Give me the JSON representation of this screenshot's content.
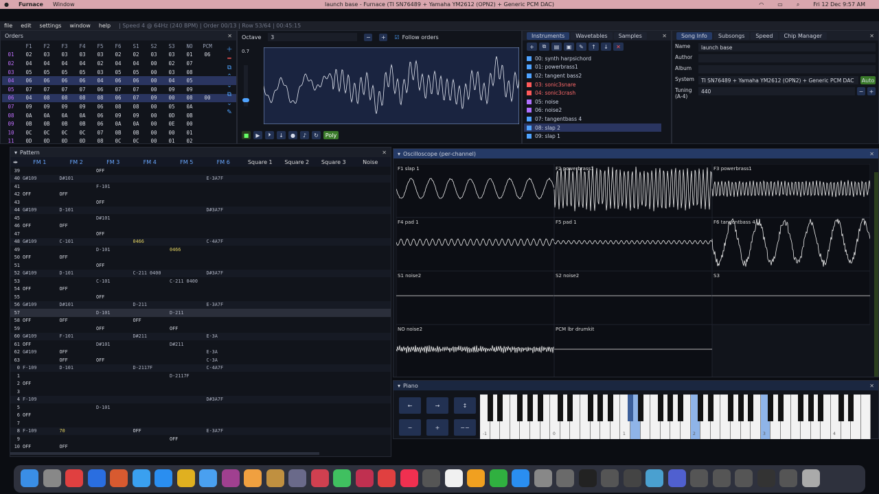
{
  "mac": {
    "apple": "",
    "app": "Furnace",
    "menu": "Window",
    "title": "launch base - Furnace (TI SN76489 + Yamaha YM2612 (OPN2) + Generic PCM DAC)",
    "datetime": "Fri 12 Dec 9:57 AM"
  },
  "menu": {
    "items": [
      "file",
      "edit",
      "settings",
      "window",
      "help"
    ],
    "status": "| Speed 4 @ 64Hz (240 BPM) | Order 00/13 | Row 53/64 | 00:45:15"
  },
  "orders": {
    "title": "Orders",
    "headers": [
      "F1",
      "F2",
      "F3",
      "F4",
      "F5",
      "F6",
      "S1",
      "S2",
      "S3",
      "NO",
      "PCM"
    ],
    "rows": [
      {
        "n": "01",
        "c": [
          "02",
          "03",
          "03",
          "03",
          "03",
          "02",
          "02",
          "03",
          "03",
          "01",
          "06"
        ]
      },
      {
        "n": "02",
        "c": [
          "04",
          "04",
          "04",
          "04",
          "02",
          "04",
          "04",
          "00",
          "02",
          "07"
        ]
      },
      {
        "n": "03",
        "c": [
          "05",
          "05",
          "05",
          "05",
          "03",
          "05",
          "05",
          "00",
          "03",
          "08"
        ]
      },
      {
        "n": "04",
        "c": [
          "06",
          "06",
          "06",
          "06",
          "04",
          "06",
          "06",
          "00",
          "04",
          "05"
        ]
      },
      {
        "n": "05",
        "c": [
          "07",
          "07",
          "07",
          "07",
          "06",
          "07",
          "07",
          "00",
          "09",
          "09"
        ]
      },
      {
        "n": "06",
        "c": [
          "04",
          "08",
          "08",
          "08",
          "08",
          "06",
          "07",
          "09",
          "00",
          "08",
          "00"
        ]
      },
      {
        "n": "07",
        "c": [
          "09",
          "09",
          "09",
          "09",
          "06",
          "08",
          "08",
          "00",
          "05",
          "0A"
        ]
      },
      {
        "n": "08",
        "c": [
          "0A",
          "0A",
          "0A",
          "0A",
          "06",
          "09",
          "09",
          "00",
          "0D",
          "0B"
        ]
      },
      {
        "n": "09",
        "c": [
          "0B",
          "0B",
          "0B",
          "0B",
          "06",
          "0A",
          "0A",
          "00",
          "0E",
          "00"
        ]
      },
      {
        "n": "10",
        "c": [
          "0C",
          "0C",
          "0C",
          "0C",
          "07",
          "0B",
          "0B",
          "00",
          "00",
          "01"
        ]
      },
      {
        "n": "11",
        "c": [
          "0D",
          "0D",
          "0D",
          "0D",
          "08",
          "0C",
          "0C",
          "00",
          "01",
          "02"
        ]
      }
    ]
  },
  "osc": {
    "title": "Octave",
    "octave": "3",
    "zoom": "0.7",
    "follow": "Follow orders",
    "poly": "Poly"
  },
  "instruments": {
    "tabs": [
      "Instruments",
      "Wavetables",
      "Samples"
    ],
    "items": [
      {
        "label": "00: synth harpsichord",
        "color": "#4fa3ff"
      },
      {
        "label": "01: powerbrass1",
        "color": "#4fa3ff"
      },
      {
        "label": "02: tangent bass2",
        "color": "#4fa3ff"
      },
      {
        "label": "03: sonic3snare",
        "color": "#ff5a5a"
      },
      {
        "label": "04: sonic3crash",
        "color": "#ff5a5a"
      },
      {
        "label": "05: noise",
        "color": "#b070ff"
      },
      {
        "label": "06: noise2",
        "color": "#b070ff"
      },
      {
        "label": "07: tangentbass 4",
        "color": "#4fa3ff"
      },
      {
        "label": "08: slap 2",
        "color": "#4fa3ff"
      },
      {
        "label": "09: slap 1",
        "color": "#4fa3ff"
      }
    ]
  },
  "song": {
    "tabs": [
      "Song Info",
      "Subsongs",
      "Speed",
      "Chip Manager"
    ],
    "name_label": "Name",
    "name": "launch base",
    "author_label": "Author",
    "author": "",
    "album_label": "Album",
    "album": "",
    "system_label": "System",
    "system": "TI SN76489 + Yamaha YM2612 (OPN2) + Generic PCM DAC",
    "auto": "Auto",
    "tuning_label": "Tuning (A-4)",
    "tuning": "440"
  },
  "pattern": {
    "title": "Pattern",
    "channels": [
      "FM 1",
      "FM 2",
      "FM 3",
      "FM 4",
      "FM 5",
      "FM 6",
      "Square 1",
      "Square 2",
      "Square 3",
      "Noise"
    ],
    "rows": [
      {
        "n": "39",
        "c": [
          "",
          "",
          "OFF",
          "",
          "",
          "",
          "",
          "",
          "",
          ""
        ]
      },
      {
        "n": "40",
        "c": [
          "G#109",
          "D#101",
          "",
          "",
          "",
          "E-3A7F",
          "",
          "",
          "",
          ""
        ]
      },
      {
        "n": "41",
        "c": [
          "",
          "",
          "F-101",
          "",
          "",
          "",
          "",
          "",
          "",
          ""
        ]
      },
      {
        "n": "42",
        "c": [
          "OFF",
          "OFF",
          "",
          "",
          "",
          "",
          "",
          "",
          "",
          ""
        ]
      },
      {
        "n": "43",
        "c": [
          "",
          "",
          "OFF",
          "",
          "",
          "",
          "",
          "",
          "",
          ""
        ]
      },
      {
        "n": "44",
        "c": [
          "G#109",
          "D-101",
          "",
          "",
          "",
          "D#3A7F",
          "",
          "",
          "",
          ""
        ]
      },
      {
        "n": "45",
        "c": [
          "",
          "",
          "D#101",
          "",
          "",
          "",
          "",
          "",
          "",
          ""
        ]
      },
      {
        "n": "46",
        "c": [
          "OFF",
          "OFF",
          "",
          "",
          "",
          "",
          "",
          "",
          "",
          ""
        ]
      },
      {
        "n": "47",
        "c": [
          "",
          "",
          "OFF",
          "",
          "",
          "",
          "",
          "",
          "",
          ""
        ]
      },
      {
        "n": "48",
        "c": [
          "G#109",
          "C-101",
          "",
          "0466",
          "",
          "C-4A7F",
          "",
          "",
          "",
          ""
        ]
      },
      {
        "n": "49",
        "c": [
          "",
          "",
          "D-101",
          "",
          "0466",
          "",
          "",
          "",
          "",
          ""
        ]
      },
      {
        "n": "50",
        "c": [
          "OFF",
          "OFF",
          "",
          "",
          "",
          "",
          "",
          "",
          "",
          ""
        ]
      },
      {
        "n": "51",
        "c": [
          "",
          "",
          "OFF",
          "",
          "",
          "",
          "",
          "",
          "",
          ""
        ]
      },
      {
        "n": "52",
        "c": [
          "G#109",
          "D-101",
          "",
          "C-211 0400",
          "",
          "D#3A7F",
          "",
          "",
          "",
          ""
        ]
      },
      {
        "n": "53",
        "c": [
          "",
          "",
          "C-101",
          "",
          "C-211 0400",
          "",
          "",
          "",
          "",
          ""
        ]
      },
      {
        "n": "54",
        "c": [
          "OFF",
          "OFF",
          "",
          "",
          "",
          "",
          "",
          "",
          "",
          ""
        ]
      },
      {
        "n": "55",
        "c": [
          "",
          "",
          "OFF",
          "",
          "",
          "",
          "",
          "",
          "",
          ""
        ]
      },
      {
        "n": "56",
        "c": [
          "G#109",
          "D#101",
          "",
          "D-211",
          "",
          "E-3A7F",
          "",
          "",
          "",
          ""
        ]
      },
      {
        "n": "57",
        "c": [
          "",
          "",
          "D-101",
          "",
          "D-211",
          "",
          "",
          "",
          "",
          ""
        ]
      },
      {
        "n": "58",
        "c": [
          "OFF",
          "OFF",
          "",
          "OFF",
          "",
          "",
          "",
          "",
          "",
          ""
        ]
      },
      {
        "n": "59",
        "c": [
          "",
          "",
          "OFF",
          "",
          "OFF",
          "",
          "",
          "",
          "",
          ""
        ]
      },
      {
        "n": "60",
        "c": [
          "G#109",
          "F-101",
          "",
          "D#211",
          "",
          "E-3A",
          "",
          "",
          "",
          ""
        ]
      },
      {
        "n": "61",
        "c": [
          "OFF",
          "",
          "D#101",
          "",
          "D#211",
          "",
          "",
          "",
          "",
          ""
        ]
      },
      {
        "n": "62",
        "c": [
          "G#109",
          "OFF",
          "",
          "",
          "",
          "E-3A",
          "",
          "",
          "",
          ""
        ]
      },
      {
        "n": "63",
        "c": [
          "",
          "OFF",
          "OFF",
          "",
          "",
          "C-3A",
          "",
          "",
          "",
          ""
        ]
      },
      {
        "n": "0",
        "c": [
          "F-109",
          "D-101",
          "",
          "D-2117F",
          "",
          "C-4A7F",
          "",
          "",
          "",
          ""
        ]
      },
      {
        "n": "1",
        "c": [
          "",
          "",
          "",
          "",
          "D-2117F",
          "",
          "",
          "",
          "",
          ""
        ]
      },
      {
        "n": "2",
        "c": [
          "OFF",
          "",
          "",
          "",
          "",
          "",
          "",
          "",
          "",
          ""
        ]
      },
      {
        "n": "3",
        "c": [
          "",
          "",
          "",
          "",
          "",
          "",
          "",
          "",
          "",
          ""
        ]
      },
      {
        "n": "4",
        "c": [
          "F-109",
          "",
          "",
          "",
          "",
          "D#3A7F",
          "",
          "",
          "",
          ""
        ]
      },
      {
        "n": "5",
        "c": [
          "",
          "",
          "D-101",
          "",
          "",
          "",
          "",
          "",
          "",
          ""
        ]
      },
      {
        "n": "6",
        "c": [
          "OFF",
          "",
          "",
          "",
          "",
          "",
          "",
          "",
          "",
          ""
        ]
      },
      {
        "n": "7",
        "c": [
          "",
          "",
          "",
          "",
          "",
          "",
          "",
          "",
          "",
          ""
        ]
      },
      {
        "n": "8",
        "c": [
          "F-109",
          "70",
          "",
          "OFF",
          "",
          "E-3A7F",
          "",
          "",
          "",
          ""
        ]
      },
      {
        "n": "9",
        "c": [
          "",
          "",
          "",
          "",
          "OFF",
          "",
          "",
          "",
          "",
          ""
        ]
      },
      {
        "n": "10",
        "c": [
          "OFF",
          "OFF",
          "",
          "",
          "",
          "",
          "",
          "",
          "",
          ""
        ]
      }
    ]
  },
  "oscope": {
    "title": "Oscilloscope (per-channel)",
    "channels": [
      {
        "label": "F1 slap 1",
        "amp": 0.45,
        "freq": 8,
        "noise": 0.1
      },
      {
        "label": "F2 powerbrass1",
        "amp": 0.9,
        "freq": 40,
        "noise": 0.3
      },
      {
        "label": "F3 powerbrass1",
        "amp": 0.35,
        "freq": 45,
        "noise": 0.2
      },
      {
        "label": "F4 pad 1",
        "amp": 0.15,
        "freq": 25,
        "noise": 0.1
      },
      {
        "label": "F5 pad 1",
        "amp": 0.08,
        "freq": 30,
        "noise": 0.05
      },
      {
        "label": "F6 tangentbass 4",
        "amp": 0.95,
        "freq": 6,
        "noise": 0.3
      },
      {
        "label": "S1 noise2",
        "amp": 0,
        "freq": 0,
        "noise": 0
      },
      {
        "label": "S2 noise2",
        "amp": 0,
        "freq": 0,
        "noise": 0
      },
      {
        "label": "S3",
        "amp": 0,
        "freq": 0,
        "noise": 0
      },
      {
        "label": "NO noise2",
        "amp": 0.12,
        "freq": 80,
        "noise": 0.9
      },
      {
        "label": "PCM lbr drumkit",
        "amp": 0,
        "freq": 0,
        "noise": 0
      }
    ]
  },
  "piano": {
    "title": "Piano",
    "octaves": [
      "-1",
      "0",
      "1",
      "2",
      "3",
      "4"
    ],
    "buttons": [
      "←",
      "→",
      "↕",
      "−",
      "+",
      "−−"
    ]
  }
}
